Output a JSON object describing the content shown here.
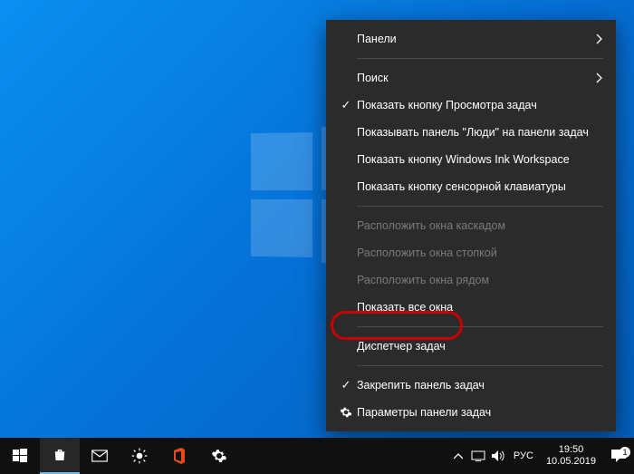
{
  "menu": {
    "panels": "Панели",
    "search": "Поиск",
    "show_task_view": "Показать кнопку Просмотра задач",
    "show_people": "Показывать панель \"Люди\" на панели задач",
    "show_ink": "Показать кнопку Windows Ink Workspace",
    "show_touch_kb": "Показать кнопку сенсорной клавиатуры",
    "cascade": "Расположить окна каскадом",
    "stacked": "Расположить окна стопкой",
    "side_by_side": "Расположить окна рядом",
    "show_desktop": "Показать все окна",
    "task_manager": "Диспетчер задач",
    "lock_taskbar": "Закрепить панель задач",
    "taskbar_settings": "Параметры панели задач"
  },
  "tray": {
    "lang": "РУС",
    "time": "19:50",
    "date": "10.05.2019",
    "notif_count": "1"
  }
}
